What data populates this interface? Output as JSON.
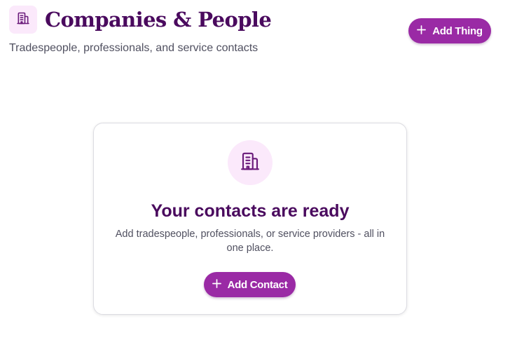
{
  "header": {
    "icon": "building-icon",
    "title": "Companies & People",
    "subtitle": "Tradespeople, professionals, and service contacts",
    "add_button": {
      "icon": "plus-icon",
      "label": "Add Thing"
    }
  },
  "empty_state": {
    "icon": "building-icon",
    "title": "Your contacts are ready",
    "description": "Add tradespeople, professionals, or service providers - all in one place.",
    "add_button": {
      "icon": "plus-icon",
      "label": "Add Contact"
    }
  },
  "colors": {
    "accent": "#9a2aa5",
    "title": "#4a0a5e",
    "icon_bg": "#fbe9fb",
    "text_muted": "#505060"
  }
}
